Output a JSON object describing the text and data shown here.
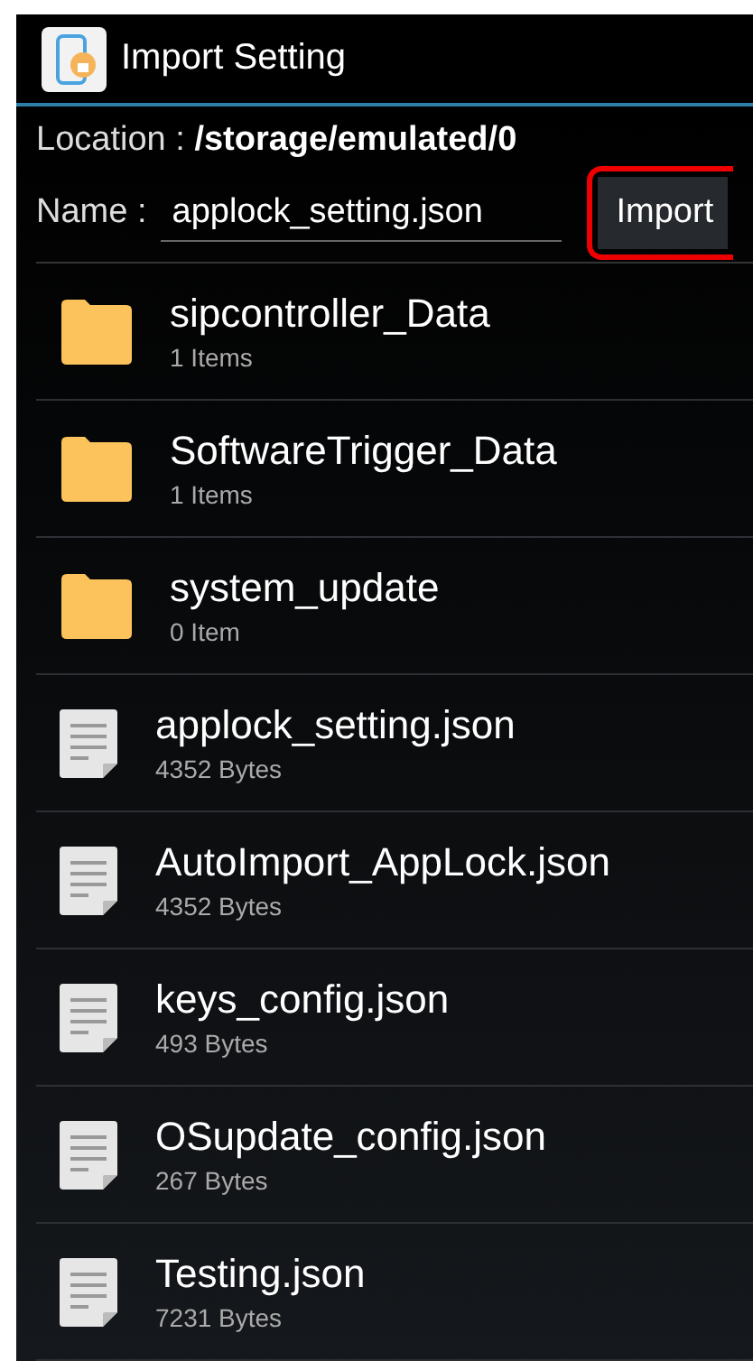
{
  "window": {
    "title": "Import Setting"
  },
  "location": {
    "label": "Location :",
    "value": "/storage/emulated/0"
  },
  "name_field": {
    "label": "Name :",
    "value": "applock_setting.json"
  },
  "import_button": {
    "label": "Import",
    "highlighted": true
  },
  "files": [
    {
      "kind": "folder",
      "name": "sipcontroller_Data",
      "detail": "1 Items"
    },
    {
      "kind": "folder",
      "name": "SoftwareTrigger_Data",
      "detail": "1 Items"
    },
    {
      "kind": "folder",
      "name": "system_update",
      "detail": "0 Item"
    },
    {
      "kind": "file",
      "name": "applock_setting.json",
      "detail": "4352 Bytes"
    },
    {
      "kind": "file",
      "name": "AutoImport_AppLock.json",
      "detail": "4352 Bytes"
    },
    {
      "kind": "file",
      "name": "keys_config.json",
      "detail": "493 Bytes"
    },
    {
      "kind": "file",
      "name": "OSupdate_config.json",
      "detail": "267 Bytes"
    },
    {
      "kind": "file",
      "name": "Testing.json",
      "detail": "7231 Bytes"
    }
  ]
}
